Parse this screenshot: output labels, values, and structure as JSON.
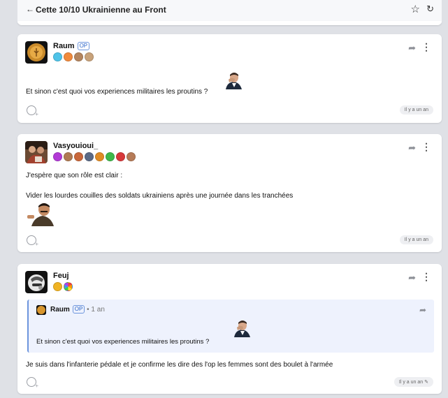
{
  "header": {
    "back_icon": "arrow-left-icon",
    "title": "Cette 10/10 Ukrainienne au Front",
    "star_icon": "star-icon",
    "reload_icon": "refresh-icon"
  },
  "posts": [
    {
      "pseudo": "Raum",
      "op_label": "OP",
      "badge_colors": [
        "#4fc3e8",
        "#f08a3c",
        "#b4855e",
        "#c8a27a"
      ],
      "text": "Et sinon c'est quoi vos experiences militaires les proutins ?",
      "date": "Il y a un an"
    },
    {
      "pseudo": "Vasyouioui_",
      "badge_colors": [
        "#b23ad6",
        "#b07a52",
        "#c9673a",
        "#5b6a86",
        "#e08b24",
        "#3fb84a",
        "#d8383a",
        "#b67b58"
      ],
      "text_line1": "J'espère que son rôle est clair :",
      "text_line2": "Vider les lourdes couilles des soldats ukrainiens après une journée dans les tranchées",
      "date": "Il y a un an"
    },
    {
      "pseudo": "Feuj",
      "badge_colors": [
        "#f0b323",
        "#8fcb4a"
      ],
      "quote": {
        "pseudo": "Raum",
        "op_label": "OP",
        "ago": "• 1 an",
        "text": "Et sinon c'est quoi vos experiences militaires les proutins ?"
      },
      "text": "Je suis dans l'infanterie pédale et je confirme les dire des l'op les femmes sont des boulet à l'armée",
      "date": "Il y a un an"
    }
  ]
}
